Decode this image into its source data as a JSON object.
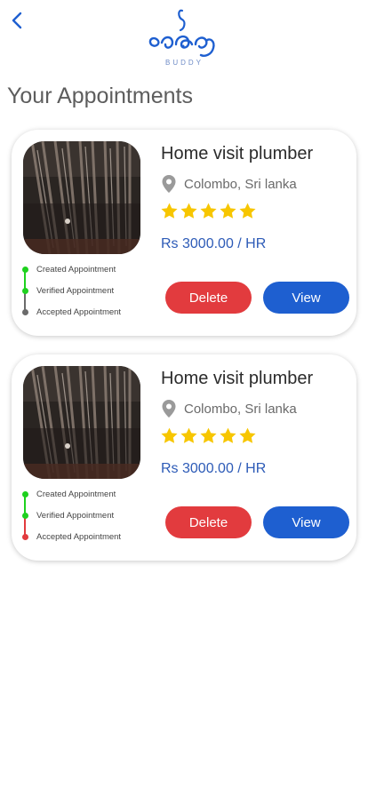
{
  "header": {
    "back_icon": "chevron-left-icon",
    "logo_word": "BUDDY",
    "accent": "#1e5fd0"
  },
  "page_title": "Your Appointments",
  "appointments": [
    {
      "title": "Home visit plumber",
      "location": "Colombo, Sri lanka",
      "rating": 5,
      "price": "Rs 3000.00 / HR",
      "delete_label": "Delete",
      "view_label": "View",
      "status_steps": [
        {
          "label": "Created Appointment",
          "color": "#1ed11e"
        },
        {
          "label": "Verified Appointment",
          "color": "#1ed11e"
        },
        {
          "label": "Accepted Appointment",
          "color": "#6b6b6b"
        }
      ]
    },
    {
      "title": "Home visit plumber",
      "location": "Colombo, Sri lanka",
      "rating": 5,
      "price": "Rs 3000.00 / HR",
      "delete_label": "Delete",
      "view_label": "View",
      "status_steps": [
        {
          "label": "Created Appointment",
          "color": "#1ed11e"
        },
        {
          "label": "Verified Appointment",
          "color": "#1ed11e"
        },
        {
          "label": "Accepted Appointment",
          "color": "#e23b3e"
        }
      ]
    }
  ],
  "colors": {
    "star": "#f7c600",
    "delete": "#e23b3e",
    "view": "#1e5fd0",
    "step_done": "#1ed11e",
    "step_pending": "#6b6b6b",
    "step_rejected": "#e23b3e"
  }
}
